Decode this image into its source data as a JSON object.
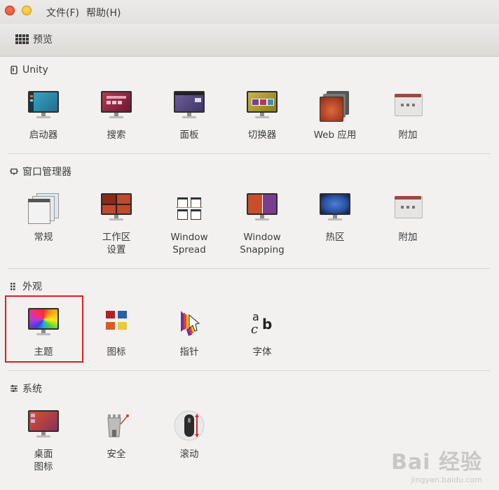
{
  "menu": [
    "文件(F)",
    "帮助(H)"
  ],
  "toolbar": {
    "preview_label": "预览"
  },
  "sections": {
    "unity": {
      "title": "Unity",
      "items": [
        "启动器",
        "搜索",
        "面板",
        "切换器",
        "Web 应用",
        "附加"
      ]
    },
    "wm": {
      "title": "窗口管理器",
      "items": [
        "常规",
        "工作区\n设置",
        "Window\nSpread",
        "Window\nSnapping",
        "热区",
        "附加"
      ]
    },
    "appearance": {
      "title": "外观",
      "items": [
        "主题",
        "图标",
        "指针",
        "字体"
      ]
    },
    "system": {
      "title": "系统",
      "items": [
        "桌面\n图标",
        "安全",
        "滚动"
      ]
    }
  },
  "watermark": {
    "main": "Bai 经验",
    "url": "jingyan.baidu.com"
  },
  "colors": {
    "highlight": "#e01e1e",
    "close": "#df4a28",
    "minimize": "#f0b42a"
  }
}
